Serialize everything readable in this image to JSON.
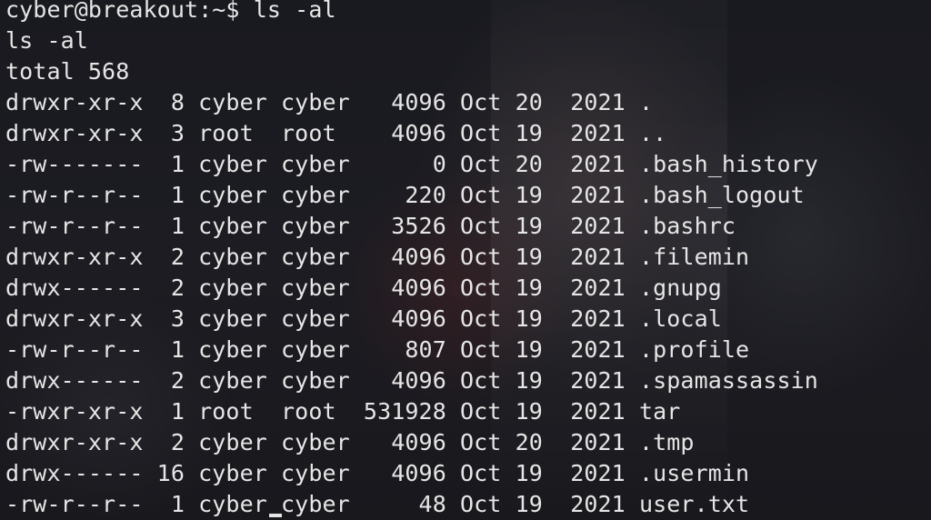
{
  "terminal": {
    "prompt": "cyber@breakout:~$ ls -al",
    "echo": "ls -al",
    "total": "total 568",
    "entries": [
      "drwxr-xr-x  8 cyber cyber   4096 Oct 20  2021 .",
      "drwxr-xr-x  3 root  root    4096 Oct 19  2021 ..",
      "-rw-------  1 cyber cyber      0 Oct 20  2021 .bash_history",
      "-rw-r--r--  1 cyber cyber    220 Oct 19  2021 .bash_logout",
      "-rw-r--r--  1 cyber cyber   3526 Oct 19  2021 .bashrc",
      "drwxr-xr-x  2 cyber cyber   4096 Oct 19  2021 .filemin",
      "drwx------  2 cyber cyber   4096 Oct 19  2021 .gnupg",
      "drwxr-xr-x  3 cyber cyber   4096 Oct 19  2021 .local",
      "-rw-r--r--  1 cyber cyber    807 Oct 19  2021 .profile",
      "drwx------  2 cyber cyber   4096 Oct 19  2021 .spamassassin",
      "-rwxr-xr-x  1 root  root  531928 Oct 19  2021 tar",
      "drwxr-xr-x  2 cyber cyber   4096 Oct 20  2021 .tmp",
      "drwx------ 16 cyber cyber   4096 Oct 19  2021 .usermin",
      "-rw-r--r--  1 cyber cyber     48 Oct 19  2021 user.txt"
    ]
  }
}
